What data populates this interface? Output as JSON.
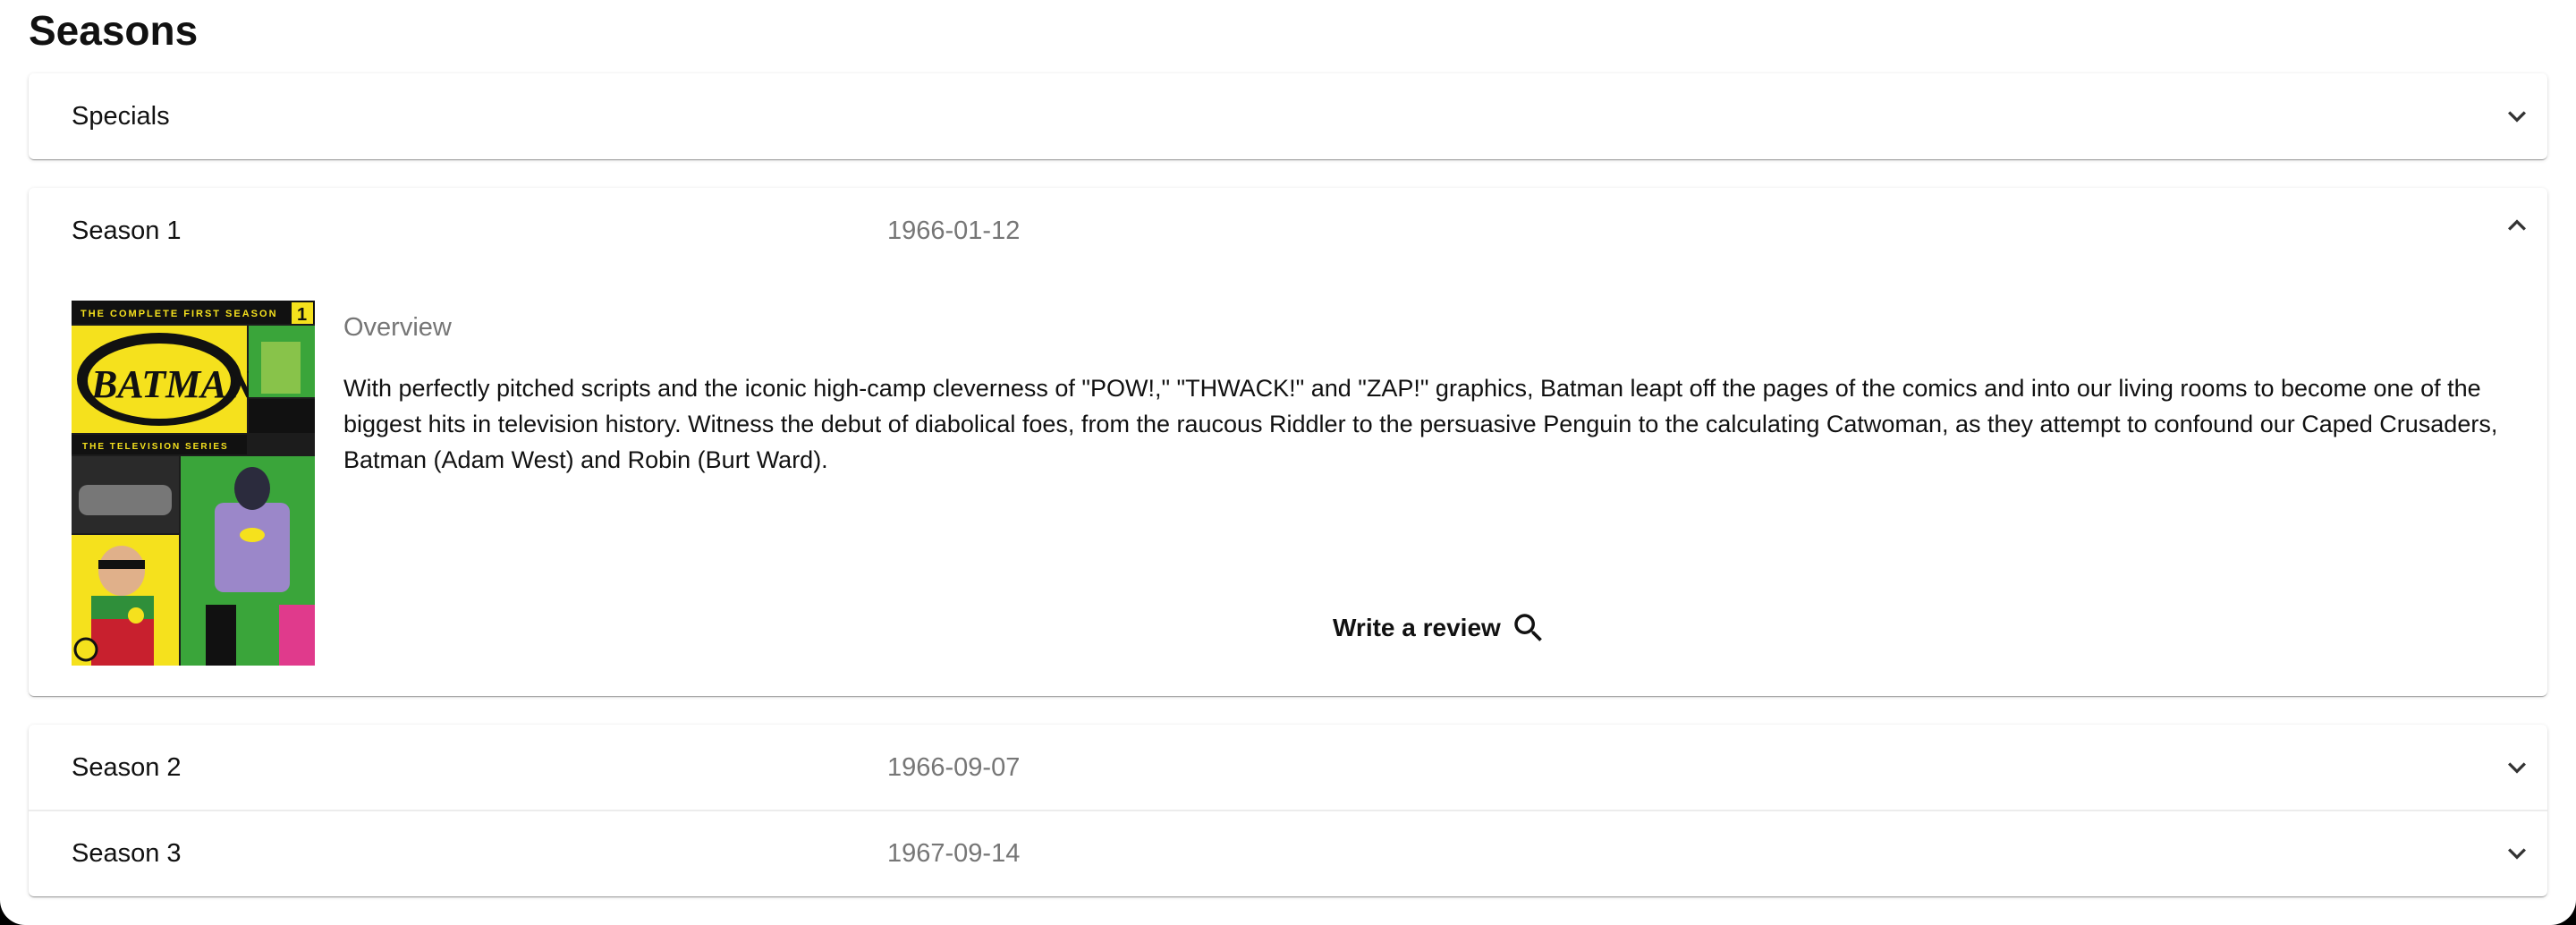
{
  "page": {
    "title": "Seasons"
  },
  "seasons": [
    {
      "name": "Specials",
      "air_date": "",
      "expanded": false,
      "icon": "chevron-down-icon"
    },
    {
      "name": "Season 1",
      "air_date": "1966-01-12",
      "expanded": true,
      "icon": "chevron-up-icon",
      "poster": {
        "banner": "THE COMPLETE FIRST SEASON",
        "number": "1",
        "logo": "BATMAN",
        "subtitle": "THE TELEVISION SERIES"
      },
      "overview_label": "Overview",
      "overview": "With perfectly pitched scripts and the iconic high-camp cleverness of \"POW!,\" \"THWACK!\" and \"ZAP!\" graphics, Batman leapt off the pages of the comics and into our living rooms to become one of the biggest hits in television history. Witness the debut of diabolical foes, from the raucous Riddler to the persuasive Penguin to the calculating Catwoman, as they attempt to confound our Caped Crusaders, Batman (Adam West) and Robin (Burt Ward).",
      "review_label": "Write a review",
      "review_icon": "search-icon"
    },
    {
      "name": "Season 2",
      "air_date": "1966-09-07",
      "expanded": false,
      "icon": "chevron-down-icon"
    },
    {
      "name": "Season 3",
      "air_date": "1967-09-14",
      "expanded": false,
      "icon": "chevron-down-icon"
    }
  ],
  "colors": {
    "background": "#ffffff",
    "outer": "#000000",
    "muted_text": "#767676",
    "poster_yellow": "#f5e11d",
    "poster_green": "#3aa53a"
  }
}
